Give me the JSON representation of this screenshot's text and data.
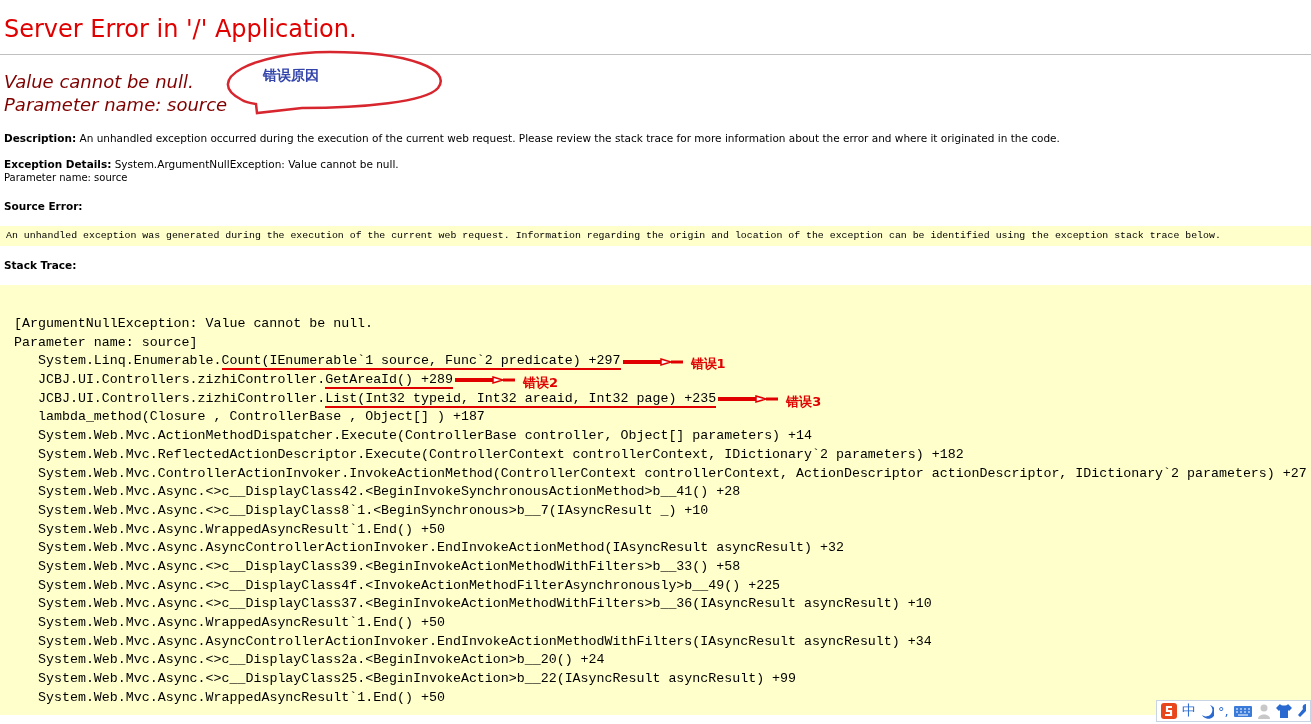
{
  "title": "Server Error in '/' Application.",
  "error_message": [
    "Value cannot be null.",
    "Parameter name: source"
  ],
  "description": {
    "label": "Description:",
    "text": "An unhandled exception occurred during the execution of the current web request. Please review the stack trace for more information about the error and where it originated in the code."
  },
  "exception_details": {
    "label": "Exception Details:",
    "text": "System.ArgumentNullException: Value cannot be null.",
    "second_line": "Parameter name: source"
  },
  "source_error": {
    "heading": "Source Error:",
    "message": "An unhandled exception was generated during the execution of the current web request. Information regarding the origin and location of the exception can be identified using the exception stack trace below."
  },
  "stack_trace": {
    "heading": "Stack Trace:",
    "lines": [
      {
        "kind": "header",
        "text": "[ArgumentNullException: Value cannot be null."
      },
      {
        "kind": "header",
        "text": "Parameter name: source]"
      },
      {
        "kind": "frame",
        "text": "System.Linq.Enumerable.",
        "marked": "Count(IEnumerable`1 source, Func`2 predicate) +297",
        "note": "错误1"
      },
      {
        "kind": "frame",
        "text": "JCBJ.UI.Controllers.zizhiController.",
        "marked": "GetAreaId() +289",
        "note": "错误2"
      },
      {
        "kind": "frame",
        "text": "JCBJ.UI.Controllers.zizhiController.",
        "marked": "List(Int32 typeid, Int32 areaid, Int32 page) +235",
        "note": "错误3"
      },
      {
        "kind": "frame",
        "text": "lambda_method(Closure , ControllerBase , Object[] ) +187"
      },
      {
        "kind": "frame",
        "text": "System.Web.Mvc.ActionMethodDispatcher.Execute(ControllerBase controller, Object[] parameters) +14"
      },
      {
        "kind": "frame",
        "text": "System.Web.Mvc.ReflectedActionDescriptor.Execute(ControllerContext controllerContext, IDictionary`2 parameters) +182"
      },
      {
        "kind": "frame",
        "text": "System.Web.Mvc.ControllerActionInvoker.InvokeActionMethod(ControllerContext controllerContext, ActionDescriptor actionDescriptor, IDictionary`2 parameters) +27"
      },
      {
        "kind": "frame",
        "text": "System.Web.Mvc.Async.<>c__DisplayClass42.<BeginInvokeSynchronousActionMethod>b__41() +28"
      },
      {
        "kind": "frame",
        "text": "System.Web.Mvc.Async.<>c__DisplayClass8`1.<BeginSynchronous>b__7(IAsyncResult _) +10"
      },
      {
        "kind": "frame",
        "text": "System.Web.Mvc.Async.WrappedAsyncResult`1.End() +50"
      },
      {
        "kind": "frame",
        "text": "System.Web.Mvc.Async.AsyncControllerActionInvoker.EndInvokeActionMethod(IAsyncResult asyncResult) +32"
      },
      {
        "kind": "frame",
        "text": "System.Web.Mvc.Async.<>c__DisplayClass39.<BeginInvokeActionMethodWithFilters>b__33() +58"
      },
      {
        "kind": "frame",
        "text": "System.Web.Mvc.Async.<>c__DisplayClass4f.<InvokeActionMethodFilterAsynchronously>b__49() +225"
      },
      {
        "kind": "frame",
        "text": "System.Web.Mvc.Async.<>c__DisplayClass37.<BeginInvokeActionMethodWithFilters>b__36(IAsyncResult asyncResult) +10"
      },
      {
        "kind": "frame",
        "text": "System.Web.Mvc.Async.WrappedAsyncResult`1.End() +50"
      },
      {
        "kind": "frame",
        "text": "System.Web.Mvc.Async.AsyncControllerActionInvoker.EndInvokeActionMethodWithFilters(IAsyncResult asyncResult) +34"
      },
      {
        "kind": "frame",
        "text": "System.Web.Mvc.Async.<>c__DisplayClass2a.<BeginInvokeAction>b__20() +24"
      },
      {
        "kind": "frame",
        "text": "System.Web.Mvc.Async.<>c__DisplayClass25.<BeginInvokeAction>b__22(IAsyncResult asyncResult) +99"
      },
      {
        "kind": "frame",
        "text": "System.Web.Mvc.Async.WrappedAsyncResult`1.End() +50"
      }
    ]
  },
  "callout": {
    "text": "错误原因"
  },
  "ime_toolbar": {
    "mode": "中",
    "punctuation": "°,"
  }
}
